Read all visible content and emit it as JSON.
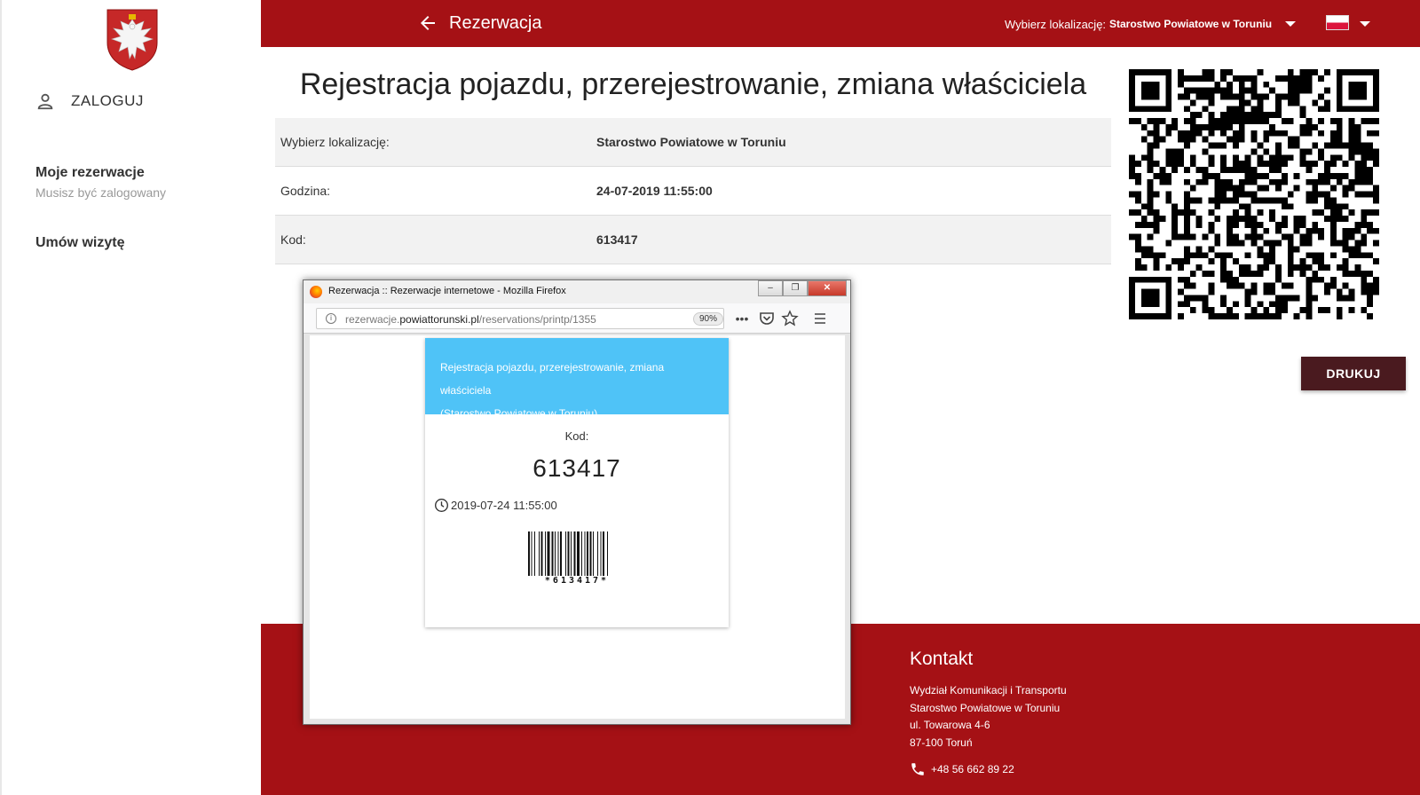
{
  "colors": {
    "brand_red": "#a51115",
    "print_button": "#4a1a1f",
    "card_header": "#4fc3f7"
  },
  "sidebar": {
    "crest_icon": "eagle-crest",
    "login_icon": "person-icon",
    "login_label": "ZALOGUJ",
    "items": [
      {
        "title": "Moje rezerwacje",
        "subtitle": "Musisz być zalogowany"
      },
      {
        "title": "Umów wizytę"
      }
    ]
  },
  "topbar": {
    "back_icon": "arrow-left-icon",
    "title": "Rezerwacja",
    "location_label": "Wybierz lokalizację:",
    "location_value": "Starostwo Powiatowe w Toruniu",
    "language_icon": "polish-flag-icon"
  },
  "main": {
    "title": "Rejestracja pojazdu, przerejestrowanie, zmiana właściciela",
    "rows": [
      {
        "label": "Wybierz lokalizację:",
        "value": "Starostwo Powiatowe w Toruniu"
      },
      {
        "label": "Godzina:",
        "value": "24-07-2019 11:55:00"
      },
      {
        "label": "Kod:",
        "value": "613417"
      }
    ],
    "qr_icon": "qr-code",
    "print_button": "DRUKUJ"
  },
  "footer": {
    "heading": "Kontakt",
    "address_lines": [
      "Wydział Komunikacji i Transportu",
      "Starostwo Powiatowe w Toruniu",
      "ul. Towarowa 4-6",
      "87-100 Toruń"
    ],
    "phone": "+48 56 662 89 22"
  },
  "firefox": {
    "window_title": "Rezerwacja :: Rezerwacje internetowe - Mozilla Firefox",
    "url_prefix": "rezerwacje.",
    "url_domain": "powiattorunski.pl",
    "url_path": "/reservations/printp/1355",
    "zoom": "90%",
    "card": {
      "header_line1": "Rejestracja pojazdu, przerejestrowanie, zmiana właściciela",
      "header_line2": "(Starostwo Powiatowe w Toruniu)",
      "code_label": "Kod:",
      "code": "613417",
      "datetime": "2019-07-24 11:55:00",
      "barcode_text": "*613417*"
    }
  }
}
